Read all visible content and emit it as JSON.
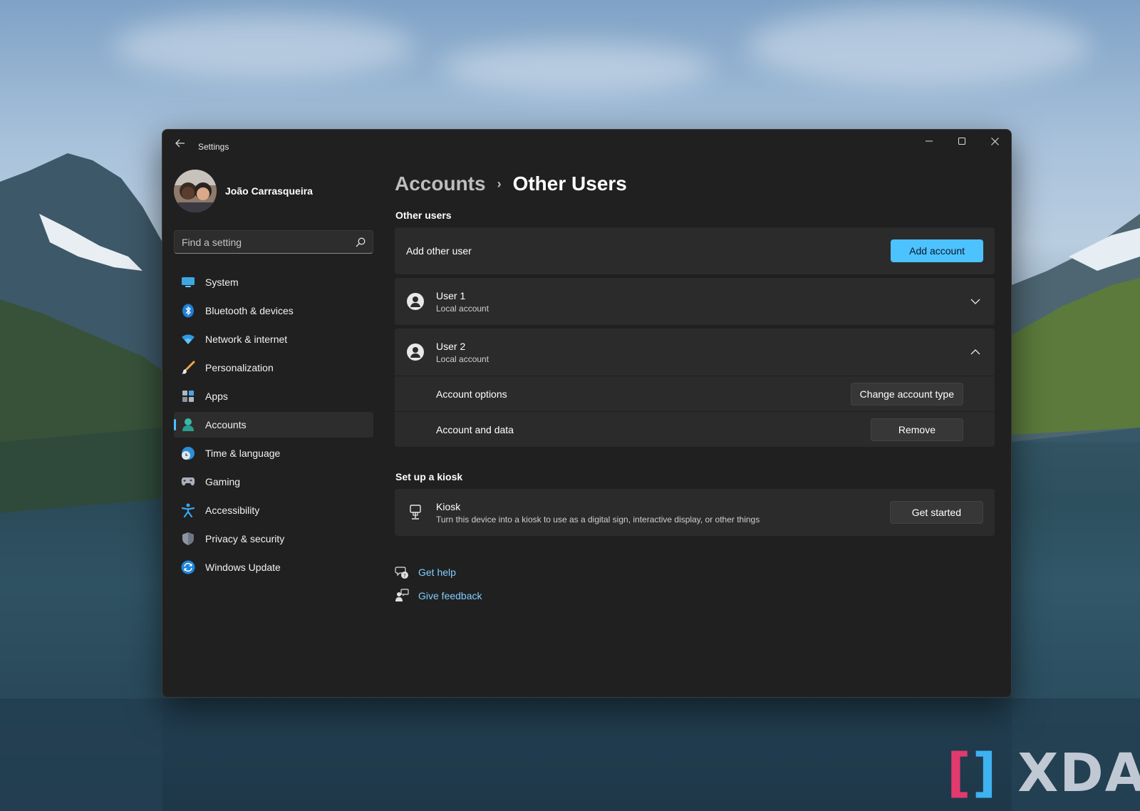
{
  "window": {
    "title": "Settings"
  },
  "profile": {
    "name": "João Carrasqueira"
  },
  "search": {
    "placeholder": "Find a setting"
  },
  "nav": {
    "items": [
      {
        "label": "System",
        "icon": "system-icon"
      },
      {
        "label": "Bluetooth & devices",
        "icon": "bluetooth-icon"
      },
      {
        "label": "Network & internet",
        "icon": "wifi-icon"
      },
      {
        "label": "Personalization",
        "icon": "brush-icon"
      },
      {
        "label": "Apps",
        "icon": "apps-icon"
      },
      {
        "label": "Accounts",
        "icon": "accounts-icon",
        "active": true
      },
      {
        "label": "Time & language",
        "icon": "clock-globe-icon"
      },
      {
        "label": "Gaming",
        "icon": "gamepad-icon"
      },
      {
        "label": "Accessibility",
        "icon": "accessibility-icon"
      },
      {
        "label": "Privacy & security",
        "icon": "shield-icon"
      },
      {
        "label": "Windows Update",
        "icon": "update-icon"
      }
    ]
  },
  "breadcrumb": {
    "parent": "Accounts",
    "separator": "›",
    "current": "Other Users"
  },
  "other_users": {
    "section_title": "Other users",
    "add": {
      "label": "Add other user",
      "button": "Add account"
    },
    "users": [
      {
        "name": "User 1",
        "type": "Local account",
        "expanded": false
      },
      {
        "name": "User 2",
        "type": "Local account",
        "expanded": true
      }
    ],
    "user2_options": {
      "account_options_label": "Account options",
      "change_type_button": "Change account type",
      "account_data_label": "Account and data",
      "remove_button": "Remove"
    }
  },
  "kiosk": {
    "section_title": "Set up a kiosk",
    "title": "Kiosk",
    "description": "Turn this device into a kiosk to use as a digital sign, interactive display, or other things",
    "button": "Get started"
  },
  "links": {
    "help": "Get help",
    "feedback": "Give feedback"
  },
  "colors": {
    "accent": "#4cc2ff",
    "window_bg": "#202020",
    "card_bg": "#2b2b2b",
    "link": "#7fcdff"
  },
  "watermark": "XDA"
}
